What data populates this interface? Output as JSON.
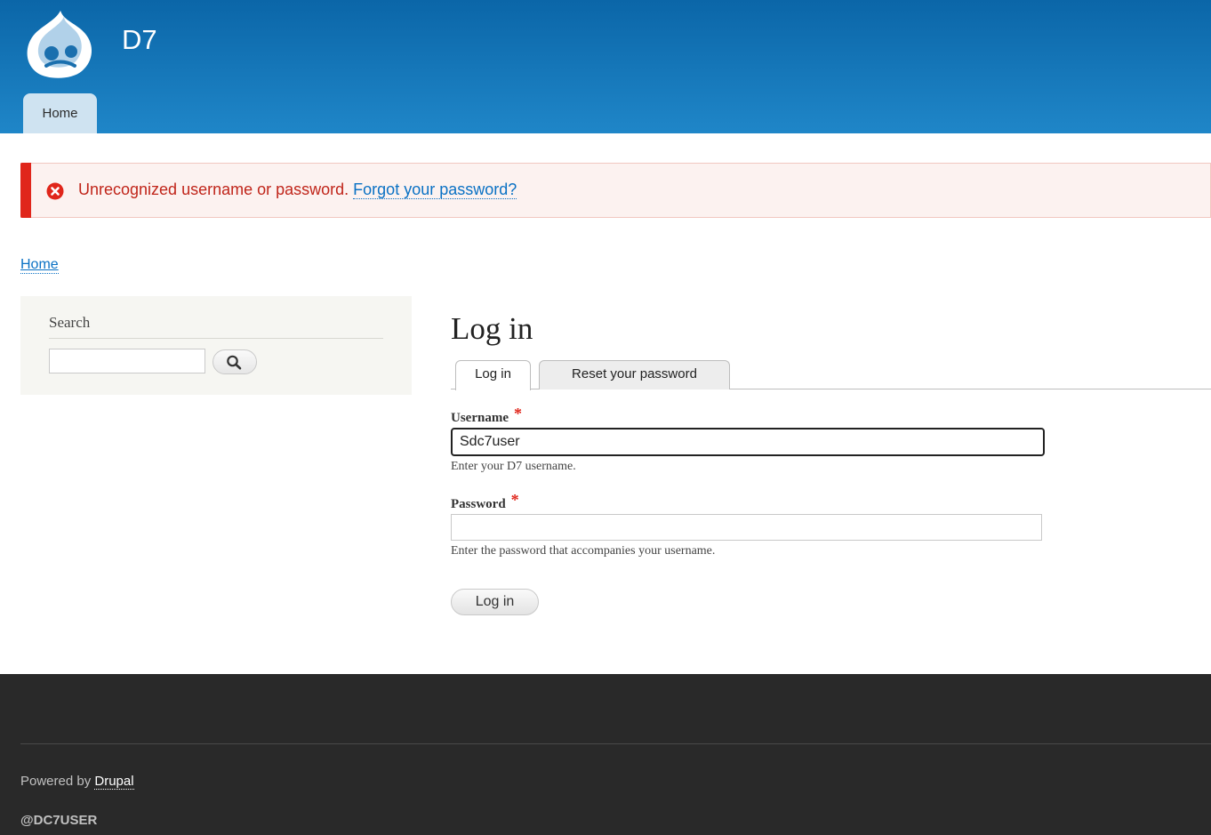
{
  "header": {
    "site_name": "D7",
    "nav": {
      "home_label": "Home"
    }
  },
  "messages": {
    "error_text": "Unrecognized username or password.",
    "forgot_link": "Forgot your password?"
  },
  "breadcrumb": {
    "home": "Home"
  },
  "sidebar": {
    "search_title": "Search",
    "search_value": ""
  },
  "main": {
    "title": "Log in",
    "tabs": [
      {
        "label": "Log in",
        "active": true
      },
      {
        "label": "Reset your password",
        "active": false
      }
    ],
    "username": {
      "label": "Username",
      "required_mark": "*",
      "value": "Sdc7user",
      "description": "Enter your D7 username."
    },
    "password": {
      "label": "Password",
      "required_mark": "*",
      "value": "",
      "description": "Enter the password that accompanies your username."
    },
    "submit_label": "Log in"
  },
  "footer": {
    "powered_prefix": "Powered by",
    "powered_link": "Drupal",
    "user_tag": "@DC7USER"
  },
  "colors": {
    "header_top": "#0b66a8",
    "header_bottom": "#1f86c8",
    "error": "#e0261b",
    "link": "#0a71c4",
    "footer_bg": "#292929"
  }
}
